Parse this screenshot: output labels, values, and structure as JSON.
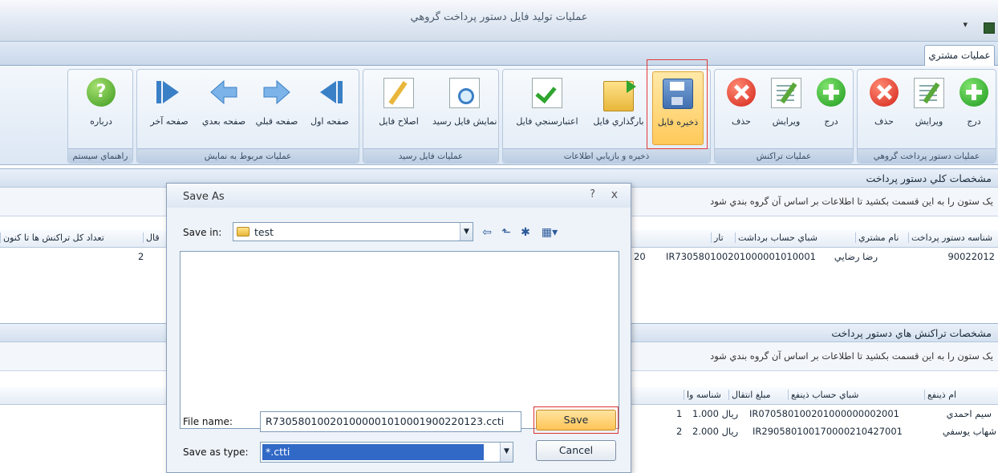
{
  "window": {
    "title": "عمليات توليد فايل دستور پرداخت گروهي",
    "quick_access": "▾"
  },
  "tabs": [
    {
      "label": "عمليات مشتري"
    }
  ],
  "ribbon": {
    "groups": [
      {
        "label": "عمليات دستور پرداخت گروهي",
        "buttons": [
          "درج",
          "ويرايش",
          "حذف"
        ]
      },
      {
        "label": "عمليات تراكنش",
        "buttons": [
          "درج",
          "ويرايش",
          "حذف"
        ]
      },
      {
        "label": "ذخيره و بازيابي اطلاعات",
        "buttons": [
          "ذخيره فايل",
          "بارگذاري فايل",
          "اعتبارسنجي فايل"
        ]
      },
      {
        "label": "عمليات فايل رسيد",
        "buttons": [
          "نمايش فايل رسيد",
          "اصلاح فايل"
        ]
      },
      {
        "label": "عمليات مربوط به نمايش",
        "buttons": [
          "صفحه اول",
          "صفحه قبلي",
          "صفحه بعدي",
          "صفحه آخر"
        ]
      },
      {
        "label": "راهنماي سيستم",
        "buttons": [
          "درباره"
        ]
      }
    ]
  },
  "section1": {
    "title": "مشخصات كلي دستور پرداخت",
    "group_hint": "يک ستون را به اين قسمت بکشيد تا اطلاعات بر اساس آن گروه بندي شود",
    "columns": [
      "شناسه دستور پرداخت",
      "نام مشتري",
      "شباي حساب برداشت",
      "تار",
      "قال",
      "تعداد كل تراكنش ها تا كنون"
    ],
    "row": {
      "payment_id": "90022012",
      "customer": "رضا رضايي",
      "iban": "IR730580100201000001010001",
      "date_partial": "20",
      "total_txn": "2"
    }
  },
  "section2": {
    "title": "مشخصات تراكنش هاي دستور پرداخت",
    "group_hint": "يک ستون را به اين قسمت بکشيد تا اطلاعات بر اساس آن گروه بندي شود",
    "columns": [
      "ام ذينفع",
      "شباي حساب ذينفع",
      "مبلغ انتقال",
      "شناسه وا"
    ],
    "rows": [
      {
        "name": "سيم احمدي",
        "iban": "IR070580100201000000002001",
        "amount": "1.000 ريال",
        "id": "1"
      },
      {
        "name": "شهاب يوسفي",
        "iban": "IR290580100170000210427001",
        "amount": "2.000 ريال",
        "id": "2"
      }
    ]
  },
  "dialog": {
    "title": "Save As",
    "help": "?",
    "close": "x",
    "save_in_label": "Save in:",
    "save_in_value": "test",
    "file_name_label": "File name:",
    "file_name_value": "R730580100201000001010001900220123.ccti",
    "save_as_type_label": "Save as type:",
    "save_as_type_value": "*.ctti",
    "save_button": "Save",
    "cancel_button": "Cancel"
  }
}
